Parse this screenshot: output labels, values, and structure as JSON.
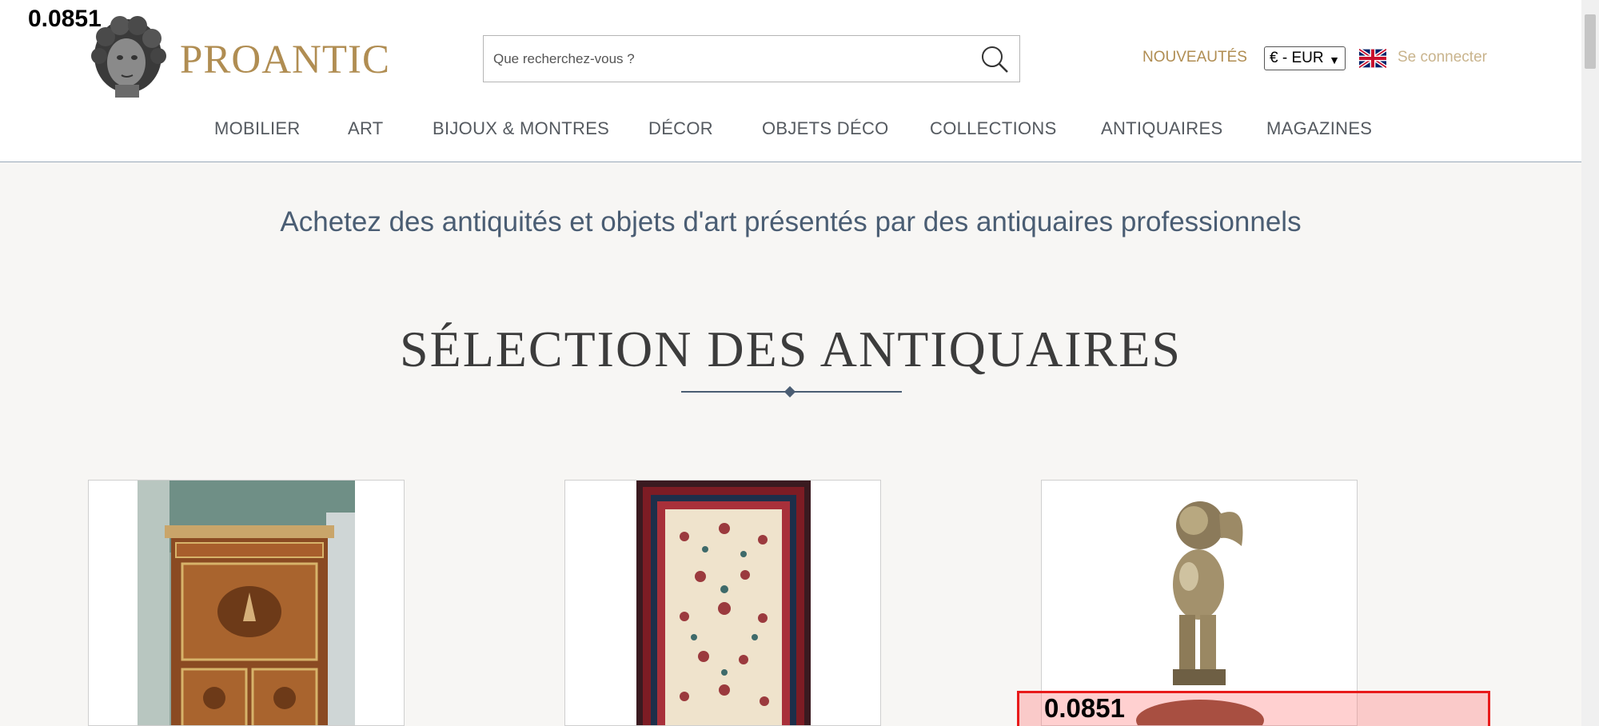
{
  "overlay": {
    "score_top": "0.0851",
    "score_box": "0.0851"
  },
  "header": {
    "brand": "PROANTIC",
    "search_placeholder": "Que recherchez-vous ?",
    "nouveautes": "NOUVEAUTÉS",
    "currency": "€ - EUR",
    "login": "Se connecter",
    "accent_color": "#b08d52"
  },
  "nav": {
    "items": [
      {
        "label": "MOBILIER"
      },
      {
        "label": "ART"
      },
      {
        "label": "BIJOUX & MONTRES"
      },
      {
        "label": "DÉCOR"
      },
      {
        "label": "OBJETS DÉCO"
      },
      {
        "label": "COLLECTIONS"
      },
      {
        "label": "ANTIQUAIRES"
      },
      {
        "label": "MAGAZINES"
      }
    ]
  },
  "main": {
    "tagline": "Achetez des antiquités et objets d'art présentés par des antiquaires professionnels",
    "section_title": "SÉLECTION DES ANTIQUAIRES",
    "cards": [
      {
        "image": "marquetry-secretaire-image"
      },
      {
        "image": "persian-rug-image"
      },
      {
        "image": "bronze-putto-statue-image"
      }
    ]
  }
}
